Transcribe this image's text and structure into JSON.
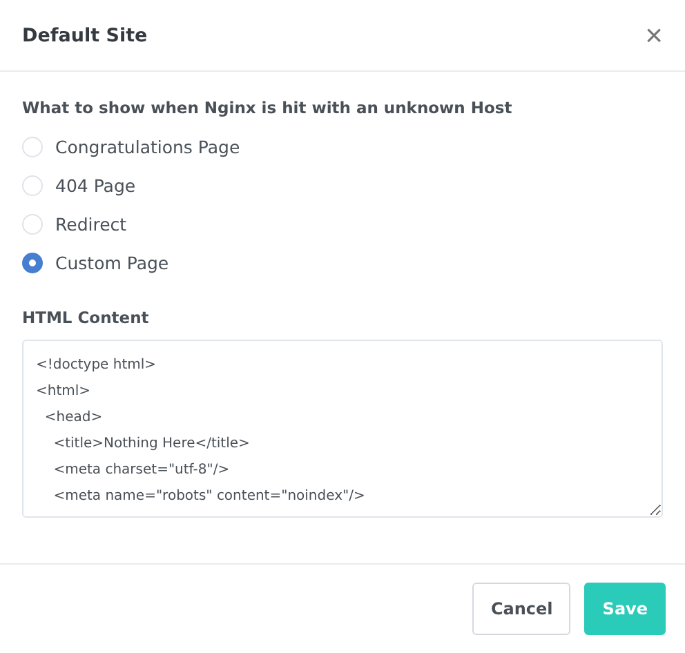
{
  "dialog": {
    "title": "Default Site",
    "close": "×"
  },
  "question": "What to show when Nginx is hit with an unknown Host",
  "options": [
    {
      "label": "Congratulations Page",
      "selected": false
    },
    {
      "label": "404 Page",
      "selected": false
    },
    {
      "label": "Redirect",
      "selected": false
    },
    {
      "label": "Custom Page",
      "selected": true
    }
  ],
  "html_content": {
    "label": "HTML Content",
    "lines": [
      "<!doctype html>",
      "<html>",
      "  <head>",
      "    <title>Nothing Here</title>",
      "    <meta charset=\"utf-8\"/>",
      "    <meta name=\"robots\" content=\"noindex\"/>"
    ]
  },
  "buttons": [
    {
      "label": "Cancel",
      "kind": "secondary"
    },
    {
      "label": "Save",
      "kind": "primary"
    }
  ]
}
